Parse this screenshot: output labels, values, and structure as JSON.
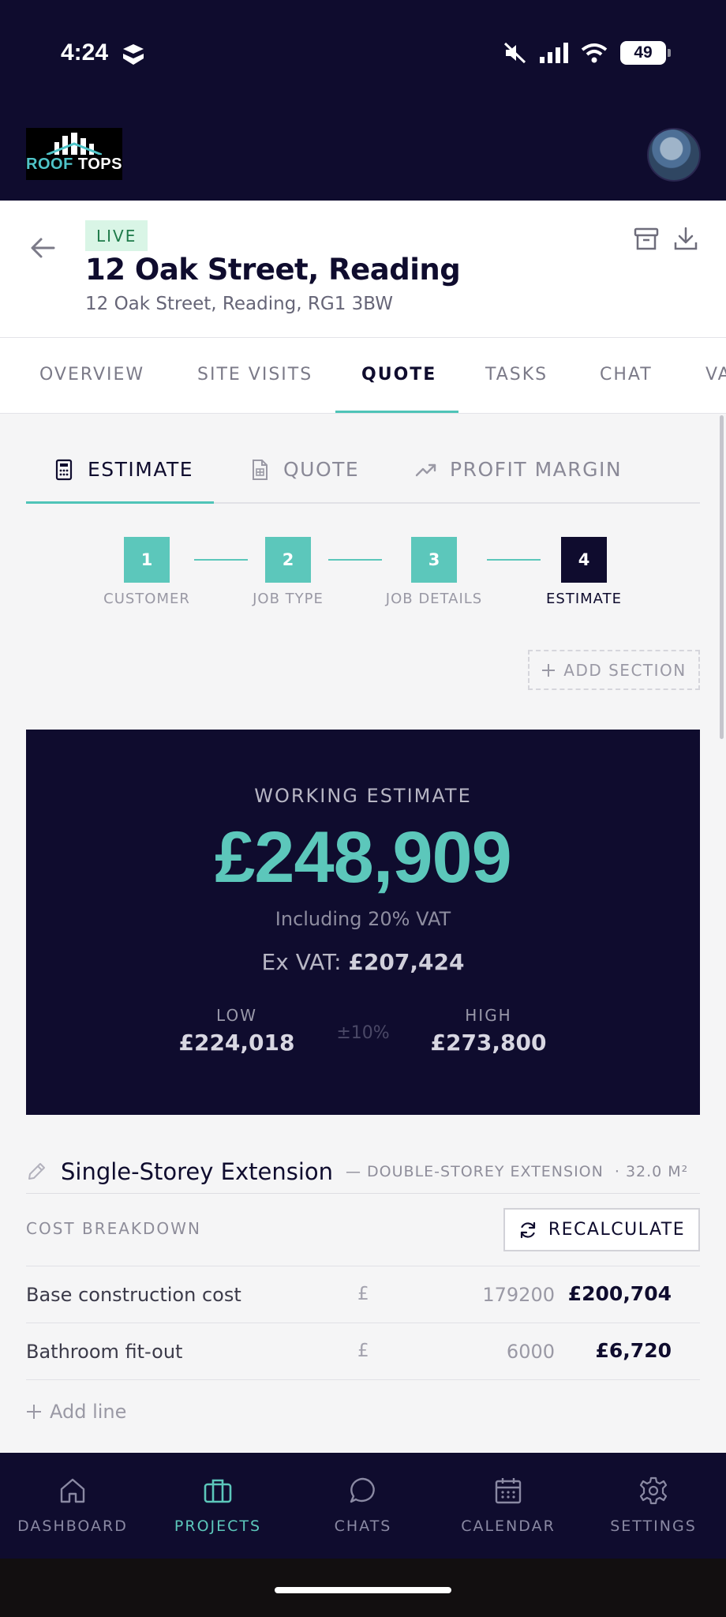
{
  "status_bar": {
    "time": "4:24",
    "battery": "49"
  },
  "brand": {
    "logo_word_1": "ROOF",
    "logo_word_2": "TOPS"
  },
  "project": {
    "status_badge": "LIVE",
    "title": "12 Oak Street, Reading",
    "address": "12 Oak Street, Reading, RG1 3BW"
  },
  "main_tabs": [
    {
      "label": "OVERVIEW"
    },
    {
      "label": "SITE VISITS"
    },
    {
      "label": "QUOTE",
      "active": true
    },
    {
      "label": "TASKS"
    },
    {
      "label": "CHAT"
    },
    {
      "label": "VA"
    }
  ],
  "sub_tabs": [
    {
      "label": "ESTIMATE",
      "active": true,
      "icon": "calculator-icon"
    },
    {
      "label": "QUOTE",
      "icon": "document-icon"
    },
    {
      "label": "PROFIT MARGIN",
      "icon": "trending-up-icon"
    }
  ],
  "steps": [
    {
      "number": "1",
      "label": "CUSTOMER",
      "state": "complete"
    },
    {
      "number": "2",
      "label": "JOB TYPE",
      "state": "complete"
    },
    {
      "number": "3",
      "label": "JOB DETAILS",
      "state": "complete"
    },
    {
      "number": "4",
      "label": "ESTIMATE",
      "state": "current"
    }
  ],
  "add_section_label": "ADD SECTION",
  "estimate": {
    "title": "WORKING ESTIMATE",
    "amount": "£248,909",
    "vat_note": "Including 20% VAT",
    "ex_vat_label": "Ex VAT:",
    "ex_vat_value": "£207,424",
    "low_label": "LOW",
    "low_value": "£224,018",
    "range": "±10%",
    "high_label": "HIGH",
    "high_value": "£273,800"
  },
  "section": {
    "name": "Single-Storey Extension",
    "type": "— DOUBLE-STOREY EXTENSION",
    "area": "· 32.0 M²"
  },
  "cost_breakdown": {
    "label": "COST BREAKDOWN",
    "recalculate_label": "RECALCULATE",
    "rows": [
      {
        "name": "Base construction cost",
        "currency": "£",
        "input": "179200",
        "total": "£200,704"
      },
      {
        "name": "Bathroom fit-out",
        "currency": "£",
        "input": "6000",
        "total": "£6,720"
      }
    ],
    "add_line_label": "Add line"
  },
  "bottom_nav": [
    {
      "label": "DASHBOARD",
      "icon": "home-icon"
    },
    {
      "label": "PROJECTS",
      "icon": "briefcase-icon",
      "active": true
    },
    {
      "label": "CHATS",
      "icon": "chat-bubble-icon"
    },
    {
      "label": "CALENDAR",
      "icon": "calendar-icon"
    },
    {
      "label": "SETTINGS",
      "icon": "gear-icon"
    }
  ],
  "colors": {
    "navy": "#0f0c2e",
    "teal": "#5cc7bb",
    "live_badge_bg": "#d9f5e6",
    "live_badge_text": "#1e7a49"
  }
}
